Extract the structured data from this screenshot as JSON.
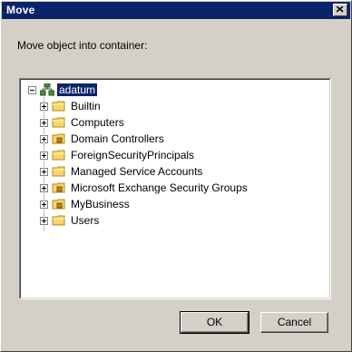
{
  "window": {
    "title": "Move"
  },
  "dialog": {
    "prompt": "Move object into container:"
  },
  "tree": {
    "root": {
      "label": "adatum",
      "icon": "domain-icon",
      "expanded": true,
      "selected": true
    },
    "children": [
      {
        "label": "Builtin",
        "icon": "folder-icon"
      },
      {
        "label": "Computers",
        "icon": "folder-icon"
      },
      {
        "label": "Domain Controllers",
        "icon": "ou-icon"
      },
      {
        "label": "ForeignSecurityPrincipals",
        "icon": "folder-icon"
      },
      {
        "label": "Managed Service Accounts",
        "icon": "folder-icon"
      },
      {
        "label": "Microsoft Exchange Security Groups",
        "icon": "ou-icon"
      },
      {
        "label": "MyBusiness",
        "icon": "ou-icon"
      },
      {
        "label": "Users",
        "icon": "folder-icon"
      }
    ]
  },
  "buttons": {
    "ok": "OK",
    "cancel": "Cancel"
  },
  "colors": {
    "titlebar": "#0a246a",
    "face": "#d4d0c8",
    "selection": "#0a246a"
  }
}
